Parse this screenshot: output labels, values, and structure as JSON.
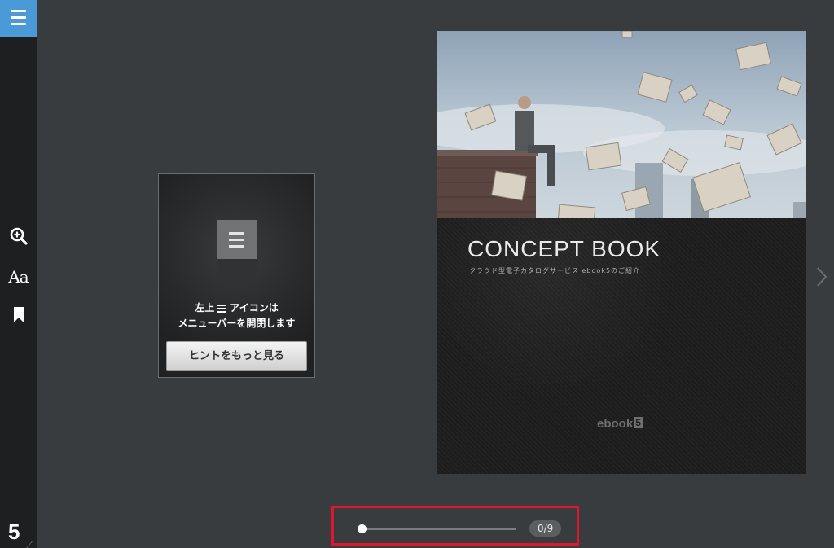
{
  "toolbar": {
    "menu_icon": "hamburger-icon",
    "zoom_icon": "zoom-in-icon",
    "font_label": "Aa",
    "bookmark_icon": "bookmark-icon",
    "logo": "5"
  },
  "hint": {
    "line1_prefix": "左上",
    "line1_suffix": "アイコンは",
    "line2": "メニューバーを開閉します",
    "button_label": "ヒントをもっと見る"
  },
  "book": {
    "title": "CONCEPT BOOK",
    "subtitle": "クラウド型電子カタログサービス ebook5のご紹介",
    "logo_text": "ebook",
    "logo_number": "5"
  },
  "navigation": {
    "next_icon": "chevron-right-icon"
  },
  "slider": {
    "current_page": 0,
    "total_pages": 9,
    "progress": 0,
    "counter_text": "0/9"
  },
  "colors": {
    "accent": "#4a9ad8",
    "highlight_border": "#e0152f",
    "background": "#383c3e",
    "sidebar": "#1e1f20"
  }
}
